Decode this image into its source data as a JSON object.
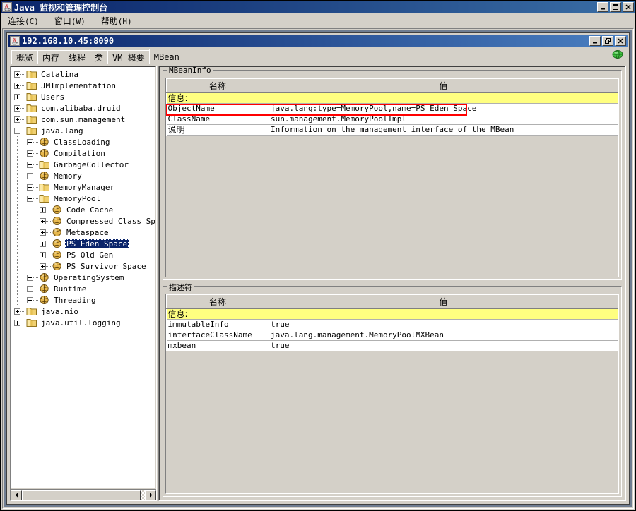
{
  "window": {
    "title": "Java 监视和管理控制台",
    "icon": "java-cup-icon",
    "buttons": {
      "minimize": "minimize-button",
      "maximize": "maximize-button",
      "close": "close-button"
    }
  },
  "menubar": {
    "items": [
      {
        "label": "连接",
        "mnemonic": "C"
      },
      {
        "label": "窗口",
        "mnemonic": "W"
      },
      {
        "label": "帮助",
        "mnemonic": "H"
      }
    ]
  },
  "internal_window": {
    "title": "192.168.10.45:8090",
    "icon": "java-cup-icon",
    "buttons": {
      "minimize": "minimize-button",
      "restore": "restore-button",
      "close": "close-button"
    }
  },
  "tabs": {
    "items": [
      {
        "label": "概览",
        "active": false
      },
      {
        "label": "内存",
        "active": false
      },
      {
        "label": "线程",
        "active": false
      },
      {
        "label": "类",
        "active": false
      },
      {
        "label": "VM 概要",
        "active": false
      },
      {
        "label": "MBean",
        "active": true
      }
    ],
    "status_icon": "connected-green-icon"
  },
  "tree": {
    "nodes": [
      {
        "label": "Catalina",
        "depth": 0,
        "toggle": "plus",
        "icon": "folder-icon",
        "selected": false
      },
      {
        "label": "JMImplementation",
        "depth": 0,
        "toggle": "plus",
        "icon": "folder-icon",
        "selected": false
      },
      {
        "label": "Users",
        "depth": 0,
        "toggle": "plus",
        "icon": "folder-icon",
        "selected": false
      },
      {
        "label": "com.alibaba.druid",
        "depth": 0,
        "toggle": "plus",
        "icon": "folder-icon",
        "selected": false
      },
      {
        "label": "com.sun.management",
        "depth": 0,
        "toggle": "plus",
        "icon": "folder-icon",
        "selected": false
      },
      {
        "label": "java.lang",
        "depth": 0,
        "toggle": "minus",
        "icon": "folder-icon",
        "selected": false
      },
      {
        "label": "ClassLoading",
        "depth": 1,
        "toggle": "plus",
        "icon": "mbean-icon",
        "selected": false
      },
      {
        "label": "Compilation",
        "depth": 1,
        "toggle": "plus",
        "icon": "mbean-icon",
        "selected": false
      },
      {
        "label": "GarbageCollector",
        "depth": 1,
        "toggle": "plus",
        "icon": "folder-icon",
        "selected": false
      },
      {
        "label": "Memory",
        "depth": 1,
        "toggle": "plus",
        "icon": "mbean-icon",
        "selected": false
      },
      {
        "label": "MemoryManager",
        "depth": 1,
        "toggle": "plus",
        "icon": "folder-icon",
        "selected": false
      },
      {
        "label": "MemoryPool",
        "depth": 1,
        "toggle": "minus",
        "icon": "folder-icon",
        "selected": false
      },
      {
        "label": "Code Cache",
        "depth": 2,
        "toggle": "plus",
        "icon": "mbean-icon",
        "selected": false
      },
      {
        "label": "Compressed Class Spa",
        "depth": 2,
        "toggle": "plus",
        "icon": "mbean-icon",
        "selected": false
      },
      {
        "label": "Metaspace",
        "depth": 2,
        "toggle": "plus",
        "icon": "mbean-icon",
        "selected": false
      },
      {
        "label": "PS Eden Space",
        "depth": 2,
        "toggle": "plus",
        "icon": "mbean-icon",
        "selected": true
      },
      {
        "label": "PS Old Gen",
        "depth": 2,
        "toggle": "plus",
        "icon": "mbean-icon",
        "selected": false
      },
      {
        "label": "PS Survivor Space",
        "depth": 2,
        "toggle": "plus",
        "icon": "mbean-icon",
        "selected": false
      },
      {
        "label": "OperatingSystem",
        "depth": 1,
        "toggle": "plus",
        "icon": "mbean-icon",
        "selected": false
      },
      {
        "label": "Runtime",
        "depth": 1,
        "toggle": "plus",
        "icon": "mbean-icon",
        "selected": false
      },
      {
        "label": "Threading",
        "depth": 1,
        "toggle": "plus",
        "icon": "mbean-icon",
        "selected": false
      },
      {
        "label": "java.nio",
        "depth": 0,
        "toggle": "plus",
        "icon": "folder-icon",
        "selected": false
      },
      {
        "label": "java.util.logging",
        "depth": 0,
        "toggle": "plus",
        "icon": "folder-icon",
        "selected": false
      }
    ],
    "scrollbar": "horizontal-scrollbar"
  },
  "mbeaninfo": {
    "title": "MBeanInfo",
    "columns": [
      "名称",
      "值"
    ],
    "info_label": "信息:",
    "rows": [
      {
        "name": "ObjectName",
        "value": "java.lang:type=MemoryPool,name=PS Eden Space",
        "highlighted": true
      },
      {
        "name": "ClassName",
        "value": "sun.management.MemoryPoolImpl",
        "highlighted": false
      },
      {
        "name": "说明",
        "value": "Information on the management interface of the MBean",
        "highlighted": false,
        "cjk": true
      }
    ]
  },
  "descriptor": {
    "title": "描述符",
    "columns": [
      "名称",
      "值"
    ],
    "info_label": "信息:",
    "rows": [
      {
        "name": "immutableInfo",
        "value": "true"
      },
      {
        "name": "interfaceClassName",
        "value": "java.lang.management.MemoryPoolMXBean"
      },
      {
        "name": "mxbean",
        "value": "true"
      }
    ]
  },
  "colors": {
    "title_bar": "#0a246a",
    "face": "#d4d0c8",
    "desktop": "#6f7d91",
    "info_row": "#ffff80",
    "selection": "#0a246a",
    "annotation": "#ff0000",
    "status_green": "#33aa33"
  }
}
